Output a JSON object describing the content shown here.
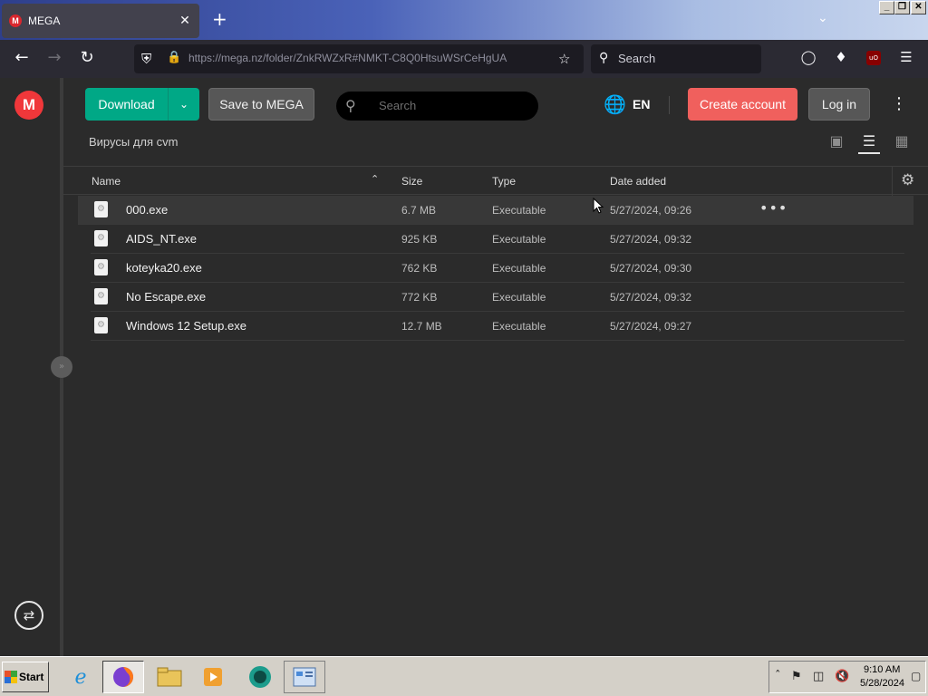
{
  "browser": {
    "tab_title": "MEGA",
    "tab_favicon": "M",
    "tab_close": "✕",
    "new_tab": "+",
    "url": "https://mega.nz/folder/ZnkRWZxR#NMKT-C8Q0HtsuWSrCeHgUA",
    "search_placeholder": "Search",
    "window_controls": [
      "_",
      "❐",
      "✕"
    ]
  },
  "mega": {
    "logo": "M",
    "download_label": "Download",
    "save_label": "Save to MEGA",
    "search_placeholder": "Search",
    "language": "EN",
    "create_account_label": "Create account",
    "login_label": "Log in",
    "folder_name": "Вирусы для cvm",
    "columns": {
      "name": "Name",
      "size": "Size",
      "type": "Type",
      "date": "Date added"
    },
    "files": [
      {
        "name": "000.exe",
        "size": "6.7 MB",
        "type": "Executable",
        "date": "5/27/2024, 09:26",
        "highlighted": true
      },
      {
        "name": "AIDS_NT.exe",
        "size": "925 KB",
        "type": "Executable",
        "date": "5/27/2024, 09:32"
      },
      {
        "name": "koteyka20.exe",
        "size": "762 KB",
        "type": "Executable",
        "date": "5/27/2024, 09:30"
      },
      {
        "name": "No Escape.exe",
        "size": "772 KB",
        "type": "Executable",
        "date": "5/27/2024, 09:32"
      },
      {
        "name": "Windows 12 Setup.exe",
        "size": "12.7 MB",
        "type": "Executable",
        "date": "5/27/2024, 09:27"
      }
    ],
    "colors": {
      "download_green": "#00a886",
      "create_account_red": "#f0605d",
      "logo_red": "#f0373a"
    }
  },
  "taskbar": {
    "start_label": "Start",
    "clock_time": "9:10 AM",
    "clock_date": "5/28/2024",
    "apps": [
      "internet-explorer-icon",
      "firefox-icon",
      "file-explorer-icon",
      "media-player-icon",
      "browser-globe-icon",
      "control-panel-icon"
    ]
  }
}
